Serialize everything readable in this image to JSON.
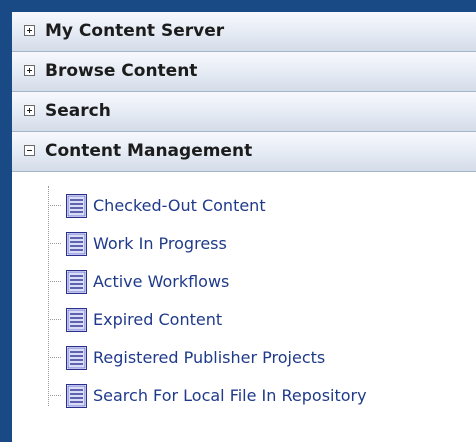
{
  "sections": [
    {
      "title": "My Content Server",
      "expanded": false
    },
    {
      "title": "Browse Content",
      "expanded": false
    },
    {
      "title": "Search",
      "expanded": false
    },
    {
      "title": "Content Management",
      "expanded": true
    }
  ],
  "content_management_items": [
    {
      "label": "Checked-Out Content",
      "icon": "document-icon"
    },
    {
      "label": "Work In Progress",
      "icon": "document-icon"
    },
    {
      "label": "Active Workflows",
      "icon": "document-icon"
    },
    {
      "label": "Expired Content",
      "icon": "document-icon"
    },
    {
      "label": "Registered Publisher Projects",
      "icon": "document-icon"
    },
    {
      "label": "Search For Local File In Repository",
      "icon": "document-icon"
    }
  ],
  "colors": {
    "frame_border": "#1a4a86",
    "header_bg": "#e3e9f3",
    "link_text": "#1f3a8a"
  }
}
